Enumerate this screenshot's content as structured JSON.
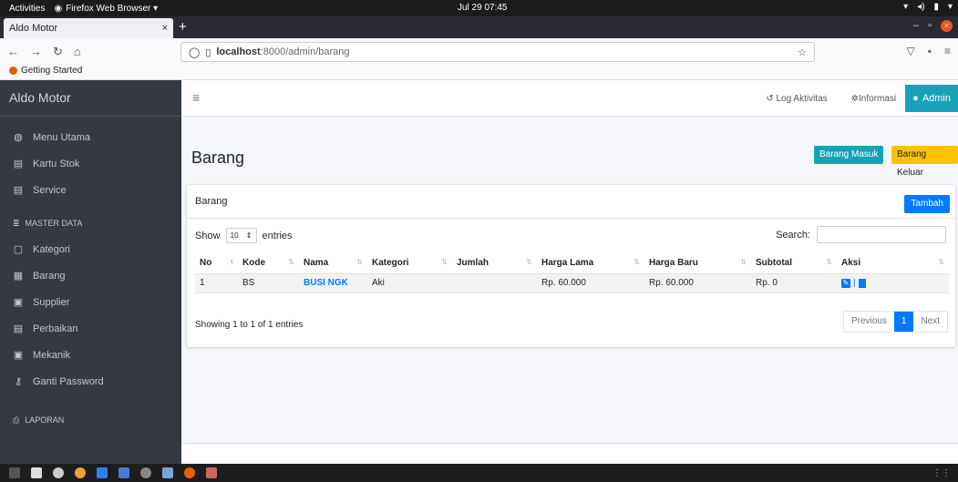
{
  "system": {
    "activities": "Activities",
    "app_menu": "Firefox Web Browser ▾",
    "clock": "Jul 29  07:45"
  },
  "browser": {
    "tab_title": "Aldo Motor",
    "url_host": "localhost",
    "url_rest": ":8000/admin/barang",
    "bookmark": "Getting Started"
  },
  "sidebar": {
    "brand": "Aldo Motor",
    "items": [
      {
        "label": "Menu Utama",
        "icon": "dashboard-icon"
      },
      {
        "label": "Kartu Stok",
        "icon": "file-icon"
      },
      {
        "label": "Service",
        "icon": "file-icon"
      }
    ],
    "master_header": "MASTER DATA",
    "master_items": [
      {
        "label": "Kategori",
        "icon": "file-outline-icon"
      },
      {
        "label": "Barang",
        "icon": "box-icon"
      },
      {
        "label": "Supplier",
        "icon": "id-card-icon"
      },
      {
        "label": "Perbaikan",
        "icon": "file-icon"
      },
      {
        "label": "Mekanik",
        "icon": "id-card-icon"
      },
      {
        "label": "Ganti Password",
        "icon": "key-icon"
      }
    ],
    "report_header": "LAPORAN"
  },
  "topnav": {
    "log": "Log Aktivitas",
    "info": "Informasi",
    "admin": "Admin"
  },
  "page": {
    "title": "Barang",
    "btn_masuk": "Barang Masuk",
    "btn_keluar": "Barang Keluar"
  },
  "card": {
    "title": "Barang",
    "btn_tambah": "Tambah",
    "show_label": "Show",
    "entries_value": "10",
    "entries_label": "entries",
    "search_label": "Search:",
    "columns": [
      "No",
      "Kode",
      "Nama",
      "Kategori",
      "Jumlah",
      "Harga Lama",
      "Harga Baru",
      "Subtotal",
      "Aksi"
    ],
    "rows": [
      {
        "no": "1",
        "kode": "BS",
        "nama": "BUSI NGK",
        "kategori": "Aki",
        "jumlah": "",
        "harga_lama": "Rp. 60.000",
        "harga_baru": "Rp. 60.000",
        "subtotal": "Rp. 0"
      }
    ],
    "info": "Showing 1 to 1 of 1 entries",
    "prev": "Previous",
    "page": "1",
    "next": "Next"
  },
  "colors": {
    "primary": "#007bff",
    "info": "#17a2b8",
    "warning": "#ffc107",
    "sidebar": "#343a40"
  }
}
